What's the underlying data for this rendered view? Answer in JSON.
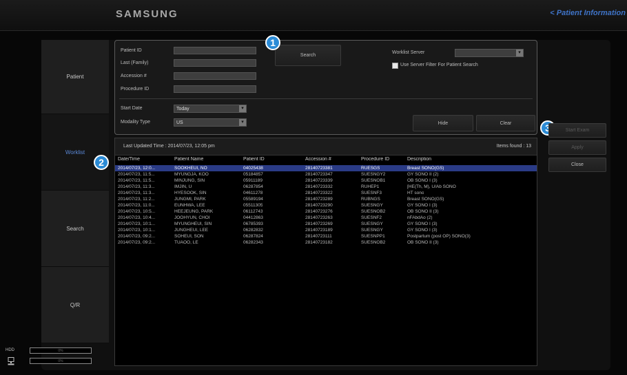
{
  "header": {
    "logo": "SAMSUNG",
    "patient_link": "< Patient Information"
  },
  "tabs": [
    {
      "label": "Patient"
    },
    {
      "label": "Worklist"
    },
    {
      "label": "Search"
    },
    {
      "label": "Q/R"
    }
  ],
  "form": {
    "patient_id_label": "Patient ID",
    "last_family_label": "Last (Family)",
    "accession_label": "Accession #",
    "procedure_id_label": "Procedure ID",
    "start_date_label": "Start Date",
    "start_date_value": "Today",
    "modality_label": "Modality Type",
    "modality_value": "US",
    "search_button": "Search",
    "worklist_server_label": "Worklist Server",
    "server_filter_label": "Use Server Filter For Patient Search",
    "hide_button": "Hide",
    "clear_button": "Clear"
  },
  "side_buttons": {
    "start_exam": "Start Exam",
    "apply": "Apply",
    "close": "Close"
  },
  "callouts": [
    "1",
    "2",
    "3"
  ],
  "list": {
    "last_updated": "Last Updated Time : 2014/07/23, 12:05 pm",
    "items_found": "Items found : 13",
    "columns": [
      "Date/Time",
      "Patient Name",
      "Patient ID",
      "Accession #",
      "Procedure ID",
      "Description"
    ],
    "rows": [
      [
        "2014/07/23, 12:0...",
        "SOOKHEUI, NO",
        "04025438",
        "28140723381",
        "RUESGS",
        "Breast SONO(GS)"
      ],
      [
        "2014/07/23, 11:5...",
        "MYUNGJA, KOO",
        "05184857",
        "28140723347",
        "SUESNGY2",
        "GY SONO II (2)"
      ],
      [
        "2014/07/23, 11:5...",
        "MINJUNG, SIN",
        "05911189",
        "28140723339",
        "SUESNOB1",
        "OB SONO I (3)"
      ],
      [
        "2014/07/23, 11:3...",
        "IMJIN, U",
        "06287854",
        "28140723332",
        "RUHEP1",
        "[HE(Th, M), U/Ab SONO"
      ],
      [
        "2014/07/23, 11:3...",
        "HYESOOK, SIN",
        "04611278",
        "28140723322",
        "SUESNF3",
        "HT sono"
      ],
      [
        "2014/07/23, 11:2...",
        "JUNGMI, PARK",
        "05589194",
        "28140723289",
        "RUBNGS",
        "Breast SONO(GS)"
      ],
      [
        "2014/07/23, 11:0...",
        "EUNHWA, LEE",
        "05511305",
        "28140723290",
        "SUESNGY",
        "GY SONO I (3)"
      ],
      [
        "2014/07/23, 10:5...",
        "HEEJEUNG, PARK",
        "06112743",
        "28140723276",
        "SUESNOB2",
        "OB SONO II (3)"
      ],
      [
        "2014/07/23, 10:4...",
        "JOOHYUN, CHOI",
        "04412863",
        "28140723263",
        "SUESNF2",
        "nFAbdAo (2)"
      ],
      [
        "2014/07/23, 10:1...",
        "MYUNGHEUI, SIN",
        "06785393",
        "28140723269",
        "SUESNGY",
        "GY SONO I (3)"
      ],
      [
        "2014/07/23, 10:1...",
        "JUNGHEUI, LEE",
        "06282832",
        "28140723189",
        "SUESNGY",
        "GY SONO I (3)"
      ],
      [
        "2014/07/23, 09:2...",
        "SOHEUI, SON",
        "06287824",
        "28140723111",
        "SUESNPP1",
        "Postpartum (post OP) SONO(3)"
      ],
      [
        "2014/07/23, 09:2...",
        "TUAOO, LE",
        "06282343",
        "28140723182",
        "SUESNOB2",
        "OB SONO II (3)"
      ]
    ]
  },
  "status": {
    "hdd_label": "HDD",
    "hdd_value": "0%",
    "pc_value": "0%",
    "pc_icon": "computer-icon"
  },
  "colors": {
    "accent": "#2b8bd6",
    "selection": "#2a3b86",
    "link": "#3f74c9"
  }
}
